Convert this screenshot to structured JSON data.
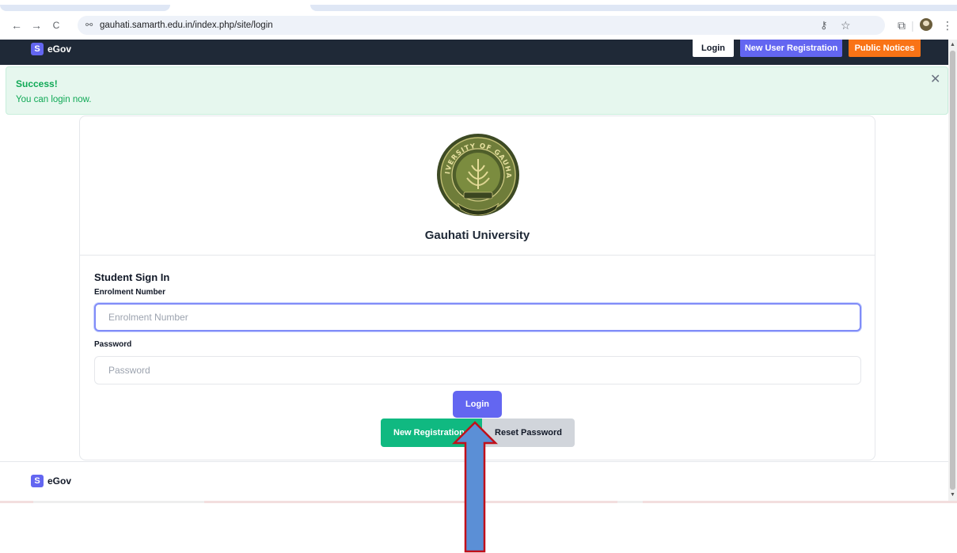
{
  "browser": {
    "url": "gauhati.samarth.edu.in/index.php/site/login",
    "back_glyph": "←",
    "forward_glyph": "→",
    "reload_glyph": "C",
    "site_info_glyph": "⚯",
    "key_glyph": "⚷",
    "star_glyph": "☆",
    "extensions_glyph": "⧉",
    "profile_glyph": "●",
    "menu_glyph": "⋮"
  },
  "navbar": {
    "badge": "S",
    "brand": "eGov",
    "login_label": "Login",
    "new_user_label": "New User Registration",
    "public_notices_label": "Public Notices"
  },
  "alert": {
    "title": "Success!",
    "message": "You can login now.",
    "close_glyph": "✕"
  },
  "university": {
    "name": "Gauhati University",
    "seal_text": "UNIVERSITY OF GAUHATI"
  },
  "form": {
    "title": "Student Sign In",
    "enrolment_label": "Enrolment Number",
    "enrolment_placeholder": "Enrolment Number",
    "password_label": "Password",
    "password_placeholder": "Password",
    "login_button": "Login",
    "new_registration_button": "New Registration",
    "reset_password_button": "Reset Password"
  },
  "footer": {
    "badge": "S",
    "brand": "eGov"
  },
  "colors": {
    "navbar": "#1f2937",
    "primary": "#6366f1",
    "notices": "#f97316",
    "success": "#10b981",
    "arrow_fill": "#5b8fd6",
    "arrow_stroke": "#c0101a"
  }
}
